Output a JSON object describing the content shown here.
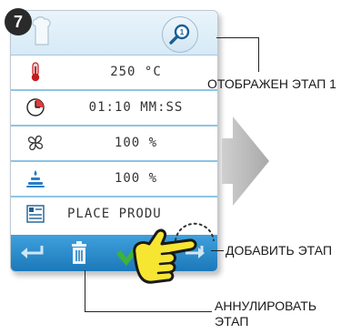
{
  "step_number": "7",
  "rows": [
    {
      "icon": "thermometer-icon",
      "value": "250 °C"
    },
    {
      "icon": "clock-icon",
      "value": "01:10 MM:SS"
    },
    {
      "icon": "fan-icon",
      "value": "100 %"
    },
    {
      "icon": "humidity-icon",
      "value": "100 %"
    },
    {
      "icon": "notes-icon",
      "value": "PLACE PRODU"
    }
  ],
  "callouts": {
    "shown_step": "ОТОБРАЖЕН ЭТАП 1",
    "add_step": "ДОБАВИТЬ ЭТАП",
    "cancel_step_line1": "АННУЛИРОВАТЬ",
    "cancel_step_line2": "ЭТАП"
  },
  "step_indicator": "1",
  "colors": {
    "accent_blue": "#2a8bcf",
    "check_green": "#3db33b",
    "row_divider": "#8ec4e4",
    "hand_yellow": "#f6e632"
  }
}
